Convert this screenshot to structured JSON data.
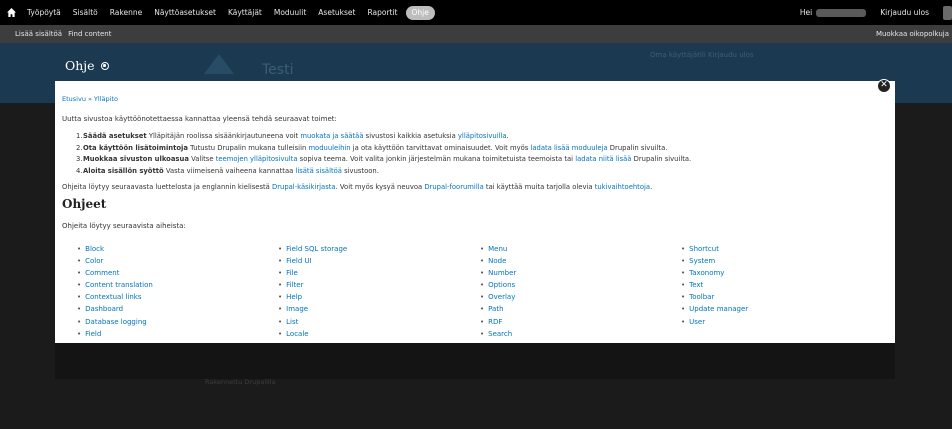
{
  "toolbar": {
    "items": [
      "Työpöytä",
      "Sisältö",
      "Rakenne",
      "Näyttöasetukset",
      "Käyttäjät",
      "Moduulit",
      "Asetukset",
      "Raportit"
    ],
    "active": "Ohje",
    "greeting": "Hei",
    "logout": "Kirjaudu ulos"
  },
  "shortcuts": {
    "items": [
      "Lisää sisältöä",
      "Find content"
    ],
    "edit": "Muokkaa oikopolkuja"
  },
  "site": {
    "name": "Testi",
    "user_links": "Oma käyttäjätili   Kirjaudu ulos",
    "powered": "Rakennettu Drupalilla"
  },
  "dialog": {
    "title": "Ohje",
    "breadcrumb": [
      "Etusivu",
      "Ylläpito"
    ],
    "intro": "Uutta sivustoa käyttöönotettaessa kannattaa yleensä tehdä seuraavat toimet:",
    "steps": [
      {
        "n": "1.",
        "bold": "Säädä asetukset",
        "t1": " Ylläpitäjän roolissa sisäänkirjautuneena voit ",
        "l1": "muokata ja säätää",
        "t2": " sivustosi kaikkia asetuksia ",
        "l2": "ylläpitosivuilla",
        "t3": ".",
        "l3": "",
        "t4": ""
      },
      {
        "n": "2.",
        "bold": "Ota käyttöön lisätoimintoja",
        "t1": " Tutustu Drupalin mukana tulleisiin ",
        "l1": "moduuleihin",
        "t2": " ja ota käyttöön tarvittavat ominaisuudet. Voit myös ",
        "l2": "ladata lisää moduuleja",
        "t3": " Drupalin sivuilta.",
        "l3": "",
        "t4": ""
      },
      {
        "n": "3.",
        "bold": "Muokkaa sivuston ulkoasua",
        "t1": " Valitse ",
        "l1": "teemojen ylläpitosivulta",
        "t2": " sopiva teema. Voit valita jonkin järjestelmän mukana toimitetuista teemoista tai ",
        "l2": "ladata niitä lisää",
        "t3": " Drupalin sivuilta.",
        "l3": "",
        "t4": ""
      },
      {
        "n": "4.",
        "bold": "Aloita sisällön syöttö",
        "t1": " Vasta viimeisenä vaiheena kannattaa ",
        "l1": "lisätä sisältöä",
        "t2": " sivustoon.",
        "l2": "",
        "t3": "",
        "l3": "",
        "t4": ""
      }
    ],
    "more": {
      "t1": "Ohjeita löytyy seuraavasta luettelosta ja englannin kielisestä ",
      "l1": "Drupal-käsikirjasta",
      "t2": ". Voit myös kysyä neuvoa ",
      "l2": "Drupal-foorumilla",
      "t3": " tai käyttää muita tarjolla olevia ",
      "l3": "tukivaihtoehtoja",
      "t4": "."
    },
    "heading": "Ohjeet",
    "topics_intro": "Ohjeita löytyy seuraavista aiheista:",
    "columns": [
      [
        "Block",
        "Color",
        "Comment",
        "Content translation",
        "Contextual links",
        "Dashboard",
        "Database logging",
        "Field"
      ],
      [
        "Field SQL storage",
        "Field UI",
        "File",
        "Filter",
        "Help",
        "Image",
        "List",
        "Locale"
      ],
      [
        "Menu",
        "Node",
        "Number",
        "Options",
        "Overlay",
        "Path",
        "RDF",
        "Search"
      ],
      [
        "Shortcut",
        "System",
        "Taxonomy",
        "Text",
        "Toolbar",
        "Update manager",
        "User"
      ]
    ]
  },
  "colors": {
    "link": "#0074bd",
    "header": "#1b3a52",
    "toolbar": "#000000"
  },
  "icons": {
    "home": "home-icon",
    "close": "close-icon",
    "title": "circle-dot-icon"
  }
}
